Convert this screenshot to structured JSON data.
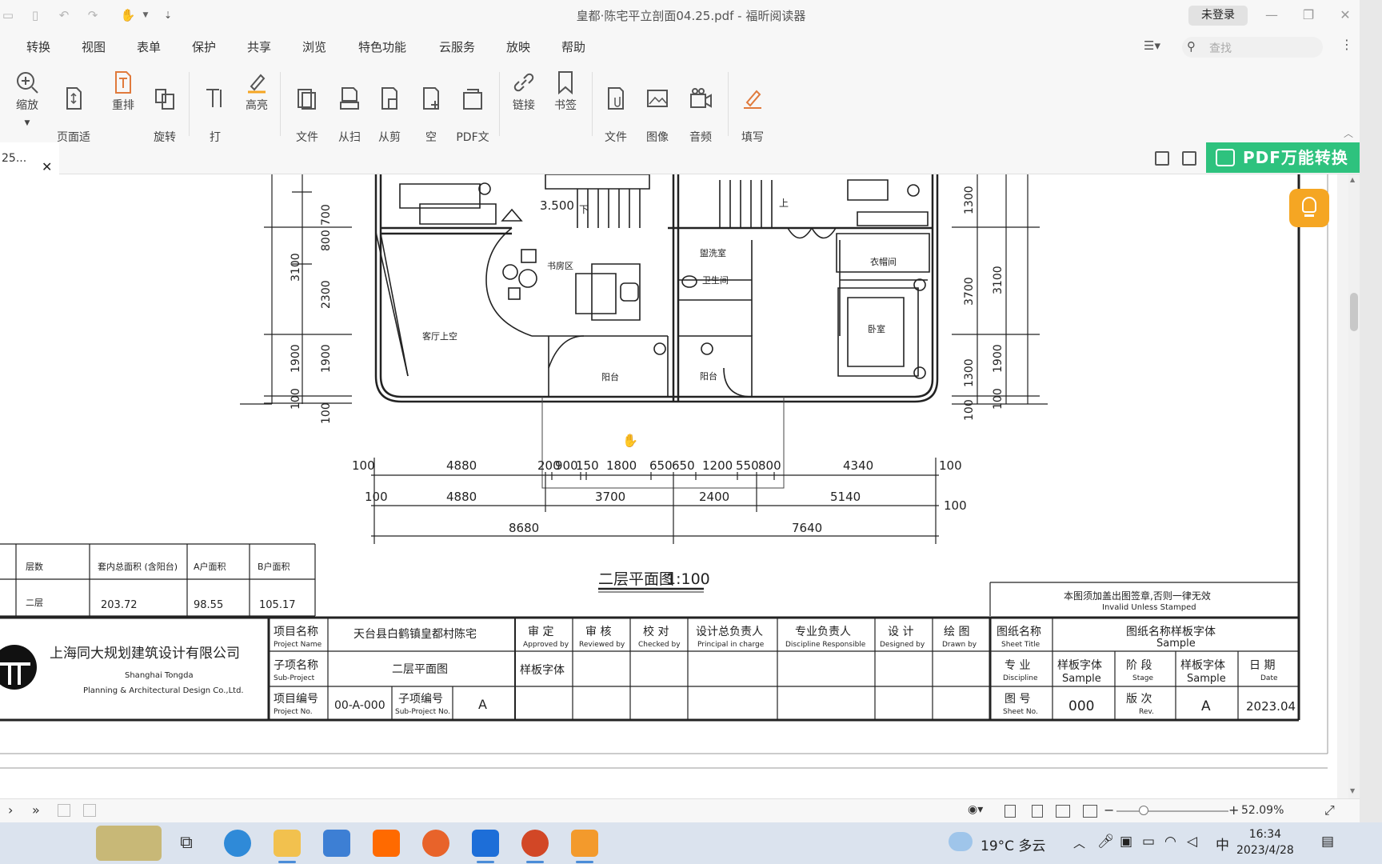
{
  "window": {
    "title": "皇都·陈宅平立剖面04.25.pdf - 福昕阅读器",
    "login_label": "未登录"
  },
  "menu": {
    "items": [
      "转换",
      "视图",
      "表单",
      "保护",
      "共享",
      "浏览",
      "特色功能",
      "云服务",
      "放映",
      "帮助"
    ],
    "search_placeholder": "查找"
  },
  "ribbon": {
    "buttons": [
      {
        "label": "缩放",
        "icon": "zoom-icon"
      },
      {
        "label": "页面适\n应选项",
        "icon": "fit-page-icon"
      },
      {
        "label": "重排",
        "icon": "reflow-icon"
      },
      {
        "label": "旋转\n视图",
        "icon": "rotate-view-icon"
      },
      {
        "label": "打\n字机",
        "icon": "typewriter-icon"
      },
      {
        "label": "高亮",
        "icon": "highlight-icon"
      },
      {
        "label": "文件\n转换",
        "icon": "file-convert-icon"
      },
      {
        "label": "从扫\n描仪",
        "icon": "scanner-icon"
      },
      {
        "label": "从剪\n贴板",
        "icon": "clipboard-icon"
      },
      {
        "label": "空\n白页",
        "icon": "blank-page-icon"
      },
      {
        "label": "PDF文\n件包",
        "icon": "pdf-package-icon"
      },
      {
        "label": "链接",
        "icon": "link-icon"
      },
      {
        "label": "书签",
        "icon": "bookmark-icon"
      },
      {
        "label": "文件\n附件",
        "icon": "attachment-icon"
      },
      {
        "label": "图像\n标注",
        "icon": "image-annotation-icon"
      },
      {
        "label": "音频\n& 视频",
        "icon": "audio-video-icon"
      },
      {
        "label": "填写\n&签名",
        "icon": "fill-sign-icon"
      }
    ]
  },
  "tabs": {
    "doc_tab": "25...",
    "close": "✕",
    "pdf_convert_label": "PDF万能转换"
  },
  "drawing": {
    "room_labels": {
      "study": "书房区",
      "living_void": "客厅上空",
      "balcony": "阳台",
      "washroom": "盥洗室",
      "wc": "卫生间",
      "closet": "衣帽间",
      "bedroom": "卧室"
    },
    "level": "3.500",
    "stair_down": "下",
    "stair_up": "上",
    "left_dims_outer": [
      "3100",
      "1900",
      "100"
    ],
    "left_dims_inner": [
      "800",
      "700",
      "2300",
      "1900",
      "100"
    ],
    "right_dims_inner": [
      "1300",
      "3700",
      "1300",
      "100"
    ],
    "right_dims_outer": [
      "3100",
      "1900",
      "100"
    ],
    "row1_dims": [
      "100",
      "4880",
      "200",
      "900",
      "150",
      "1800",
      "650",
      "650",
      "1200",
      "550",
      "800",
      "4340",
      "100"
    ],
    "row2_dims": [
      "100",
      "4880",
      "3700",
      "2400",
      "5140",
      "100"
    ],
    "row3_dims": [
      "8680",
      "7640"
    ],
    "drawing_title": "二层平面图",
    "drawing_scale": "1:100",
    "area_table": {
      "headers": [
        "层数",
        "套内总面积 (含阳台)",
        "A户面积",
        "B户面积"
      ],
      "rows": [
        [
          "二层",
          "203.72",
          "98.55",
          "105.17"
        ]
      ]
    },
    "stamp_note_cn": "本图须加盖出图签章,否则一律无效",
    "stamp_note_en": "Invalid Unless Stamped"
  },
  "title_block": {
    "company_cn": "上海同大规划建筑设计有限公司",
    "company_en1": "Shanghai Tongda",
    "company_en2": "Planning & Architectural Design Co.,Ltd.",
    "project_name_cn": "项目名称",
    "project_name_en": "Project Name",
    "project_name_val": "天台县白鹤镇皇都村陈宅",
    "sub_project_cn": "子项名称",
    "sub_project_en": "Sub-Project",
    "sub_project_val": "二层平面图",
    "project_no_cn": "项目编号",
    "project_no_en": "Project No.",
    "project_no_val": "00-A-000",
    "sub_no_cn": "子项编号",
    "sub_no_en": "Sub-Project No.",
    "sub_no_val": "A",
    "roles": [
      {
        "cn": "审 定",
        "en": "Approved by"
      },
      {
        "cn": "审 核",
        "en": "Reviewed by"
      },
      {
        "cn": "校 对",
        "en": "Checked by"
      },
      {
        "cn": "设计总负责人",
        "en": "Principal in charge"
      },
      {
        "cn": "专业负责人",
        "en": "Discipline Responsible"
      },
      {
        "cn": "设 计",
        "en": "Designed by"
      },
      {
        "cn": "绘 图",
        "en": "Drawn by"
      }
    ],
    "sample_font": "样板字体",
    "sheet_title_cn": "图纸名称",
    "sheet_title_en": "Sheet Title",
    "sheet_title_val_cn": "图纸名称样板字体",
    "sheet_title_val_en": "Sample",
    "discipline_cn": "专 业",
    "discipline_en": "Discipline",
    "discipline_val_cn": "样板字体",
    "discipline_val_en": "Sample",
    "stage_cn": "阶 段",
    "stage_en": "Stage",
    "stage_val_cn": "样板字体",
    "stage_val_en": "Sample",
    "date_cn": "日 期",
    "date_en": "Date",
    "sheet_no_cn": "图 号",
    "sheet_no_en": "Sheet No.",
    "sheet_no_val": "000",
    "rev_cn": "版 次",
    "rev_en": "Rev.",
    "rev_val": "A",
    "date_val": "2023.04"
  },
  "statusbar": {
    "zoom": "52.09%"
  },
  "taskbar": {
    "weather": "19°C 多云",
    "ime": "中",
    "time": "16:34",
    "date": "2023/4/28",
    "apps": [
      "task-view-icon",
      "edge-icon",
      "file-explorer-icon",
      "mail-icon",
      "mi-icon",
      "firefox-icon",
      "photos-icon",
      "powerpoint-icon",
      "foxit-reader-icon"
    ]
  },
  "colors": {
    "accent_green": "#2ec27e",
    "hint_orange": "#f5a623",
    "drawing_line": "#222222"
  }
}
